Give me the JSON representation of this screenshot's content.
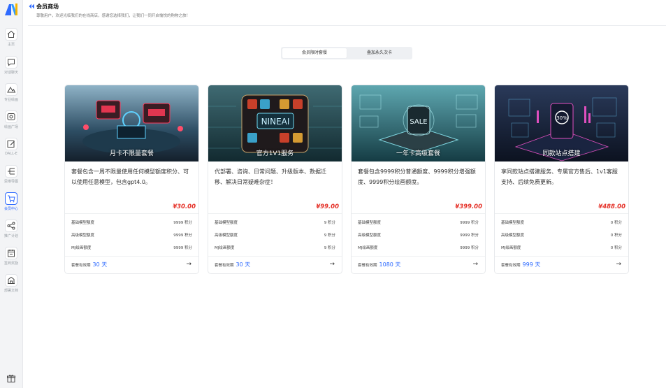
{
  "sidebar": {
    "items": [
      {
        "label": "主页",
        "icon": "home-icon"
      },
      {
        "label": "对话聊天",
        "icon": "chat-icon"
      },
      {
        "label": "专业绘画",
        "icon": "paint-icon"
      },
      {
        "label": "绘画广场",
        "icon": "gallery-icon"
      },
      {
        "label": "DALL-E",
        "icon": "edit-icon"
      },
      {
        "label": "思维导图",
        "icon": "mindmap-icon"
      },
      {
        "label": "会员中心",
        "icon": "cart-icon",
        "active": true
      },
      {
        "label": "推广计划",
        "icon": "share-icon"
      },
      {
        "label": "签到奖励",
        "icon": "calendar-icon"
      },
      {
        "label": "部署文档",
        "icon": "building-icon"
      }
    ]
  },
  "header": {
    "title": "会员商场",
    "subtitle": "尊敬用户，欢迎光临我们的在线商店，感谢您选择我们，让我们一同开启愉悦的购物之旅！"
  },
  "tabs": [
    "会员限时套餐",
    "叠加永久次卡"
  ],
  "active_tab": 0,
  "cards": [
    {
      "image_caption": "月卡不限量套餐",
      "description": "套餐包含一周不限量使用任何模型额度积分、可以使用任意模型，包含gpt4.0。",
      "price": "¥30.00",
      "rows": [
        {
          "label": "基础模型额度",
          "value": "9999 积分"
        },
        {
          "label": "高级模型额度",
          "value": "9999 积分"
        },
        {
          "label": "MJ绘画额度",
          "value": "9999 积分"
        }
      ],
      "validity_label": "套餐有效期",
      "validity_days": "30 天"
    },
    {
      "image_caption": "官方1V1服务",
      "description": "代部署、咨询、日常问题、升级版本、数据迁移、解决日常疑难杂症！",
      "price": "¥99.00",
      "rows": [
        {
          "label": "基础模型额度",
          "value": "9 积分"
        },
        {
          "label": "高级模型额度",
          "value": "9 积分"
        },
        {
          "label": "MJ绘画额度",
          "value": "9 积分"
        }
      ],
      "validity_label": "套餐有效期",
      "validity_days": "30 天"
    },
    {
      "image_caption": "一年卡高级套餐",
      "description": "套餐包含9999积分普通额度、9999积分增强额度、9999积分绘画额度。",
      "price": "¥399.00",
      "rows": [
        {
          "label": "基础模型额度",
          "value": "9999 积分"
        },
        {
          "label": "高级模型额度",
          "value": "9999 积分"
        },
        {
          "label": "MJ绘画额度",
          "value": "9999 积分"
        }
      ],
      "validity_label": "套餐有效期",
      "validity_days": "1080 天"
    },
    {
      "image_caption": "同款站点搭建",
      "description": "享同款站点搭建服务、专属官方售后、1v1客服支持、后续免费更新。",
      "price": "¥488.00",
      "rows": [
        {
          "label": "基础模型额度",
          "value": "0 积分"
        },
        {
          "label": "高级模型额度",
          "value": "0 积分"
        },
        {
          "label": "MJ绘画额度",
          "value": "0 积分"
        }
      ],
      "validity_label": "套餐有效期",
      "validity_days": "999 天"
    }
  ],
  "colors": {
    "accent": "#2f6bff",
    "price": "#e5332a"
  }
}
